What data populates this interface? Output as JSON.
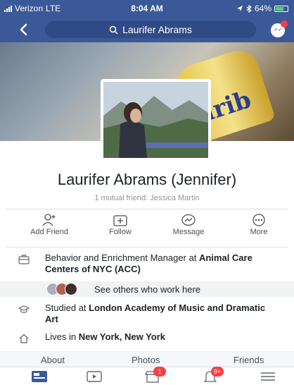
{
  "status_bar": {
    "carrier": "Verizon",
    "network": "LTE",
    "time": "8:04 AM",
    "battery": "64%"
  },
  "nav": {
    "search_text": "Laurifer Abrams",
    "msgr_badge": "1"
  },
  "cover": {
    "can_text": "arib"
  },
  "profile": {
    "name": "Laurifer Abrams (Jennifer)",
    "mutual_friends": "1 mutual friend: Jessica Martin"
  },
  "actions": [
    {
      "label": "Add Friend"
    },
    {
      "label": "Follow"
    },
    {
      "label": "Message"
    },
    {
      "label": "More"
    }
  ],
  "work": {
    "prefix": "Behavior and Enrichment Manager at ",
    "employer": "Animal Care Centers of NYC (ACC)"
  },
  "coworkers": {
    "label": "See others who work here"
  },
  "education": {
    "prefix": "Studied at ",
    "school": "London Academy of Music and Dramatic Art"
  },
  "location": {
    "prefix": "Lives in ",
    "city": "New York, New York"
  },
  "tabs": [
    "About",
    "Photos",
    "Friends"
  ],
  "tabbar": {
    "marketplace_badge": "1",
    "notifications_badge": "9+"
  },
  "colors": {
    "brand": "#3b5998",
    "badge": "#fa3e3e",
    "text": "#1d2129",
    "muted": "#90949c"
  }
}
